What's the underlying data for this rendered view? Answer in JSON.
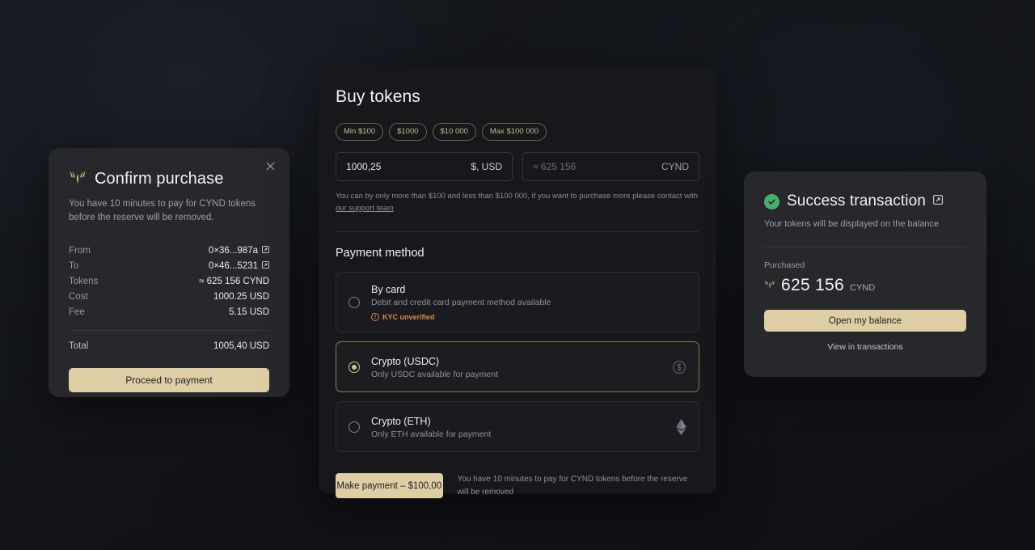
{
  "confirm": {
    "title": "Confirm purchase",
    "logo_icon": "cynd-wing-logo-icon",
    "close_icon": "close-icon",
    "subtitle": "You have 10 minutes to pay for CYND tokens before the reserve will be removed.",
    "rows": [
      {
        "label": "From",
        "value": "0×36...987a",
        "link": true
      },
      {
        "label": "To",
        "value": "0×46...5231",
        "link": true
      },
      {
        "label": "Tokens",
        "value": "≈ 625 156 CYND",
        "link": false
      },
      {
        "label": "Cost",
        "value": "1000.25 USD",
        "link": false
      },
      {
        "label": "Fee",
        "value": "5.15 USD",
        "link": false
      }
    ],
    "total_label": "Total",
    "total_value": "1005,40 USD",
    "proceed_label": "Proceed to payment"
  },
  "buy": {
    "title": "Buy tokens",
    "chips": [
      "Min $100",
      "$1000",
      "$10 000",
      "Max $100 000"
    ],
    "amount_input": {
      "value": "1000,25",
      "unit": "$, USD"
    },
    "token_input": {
      "placeholder": "≈ 625 156",
      "unit": "CYND"
    },
    "hint_text": "You can by only more than $100 and less than $100 000, if you want to purchase more please contact with ",
    "hint_link": "our support team",
    "payment_method_title": "Payment method",
    "methods": [
      {
        "name": "By card",
        "desc": "Debit and credit card payment method available",
        "selected": false,
        "badge": "KYC unverified",
        "icon": ""
      },
      {
        "name": "Crypto (USDC)",
        "desc": "Only USDC available for payment",
        "selected": true,
        "badge": "",
        "icon": "dollar-circle-icon"
      },
      {
        "name": "Crypto (ETH)",
        "desc": "Only ETH available for payment",
        "selected": false,
        "badge": "",
        "icon": "ethereum-icon"
      }
    ],
    "pay_button": "Make payment – $100,00",
    "pay_note": "You have 10 minutes to pay for CYND tokens before the reserve will be removed"
  },
  "success": {
    "title": "Success transaction",
    "check_icon": "success-check-icon",
    "external_icon": "external-link-icon",
    "subtitle": "Your tokens will be displayed on the balance",
    "purchased_label": "Purchased",
    "amount": "625 156",
    "ticker": "CYND",
    "open_balance_label": "Open my balance",
    "view_transactions_label": "View in transactions"
  },
  "colors": {
    "gold": "#ddcea3",
    "chip_border": "#6e6245",
    "warning": "#d98b3f",
    "success": "#4caf69",
    "card_light": "#26282c",
    "card_dark": "#16181c"
  }
}
